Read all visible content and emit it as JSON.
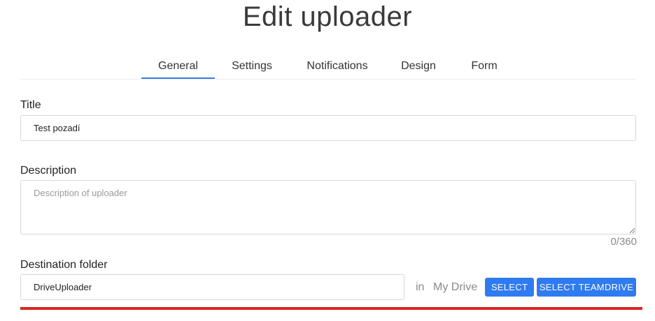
{
  "page": {
    "title": "Edit uploader"
  },
  "tabs": [
    {
      "label": "General",
      "active": true
    },
    {
      "label": "Settings",
      "active": false
    },
    {
      "label": "Notifications",
      "active": false
    },
    {
      "label": "Design",
      "active": false
    },
    {
      "label": "Form",
      "active": false
    }
  ],
  "fields": {
    "title": {
      "label": "Title",
      "value": "Test pozadí"
    },
    "description": {
      "label": "Description",
      "value": "",
      "placeholder": "Description of uploader",
      "counter": "0/360"
    },
    "destination": {
      "label": "Destination folder",
      "value": "DriveUploader",
      "in_label": "in",
      "drive_name": "My Drive",
      "select_label": "SELECT",
      "select_teamdrive_label": "SELECT TEAMDRIVE"
    }
  },
  "colors": {
    "accent": "#3b7ddd",
    "button": "#2f7bf0",
    "error_bar": "#d92424"
  },
  "icons": {
    "resize_handle": "resize-handle-icon"
  }
}
